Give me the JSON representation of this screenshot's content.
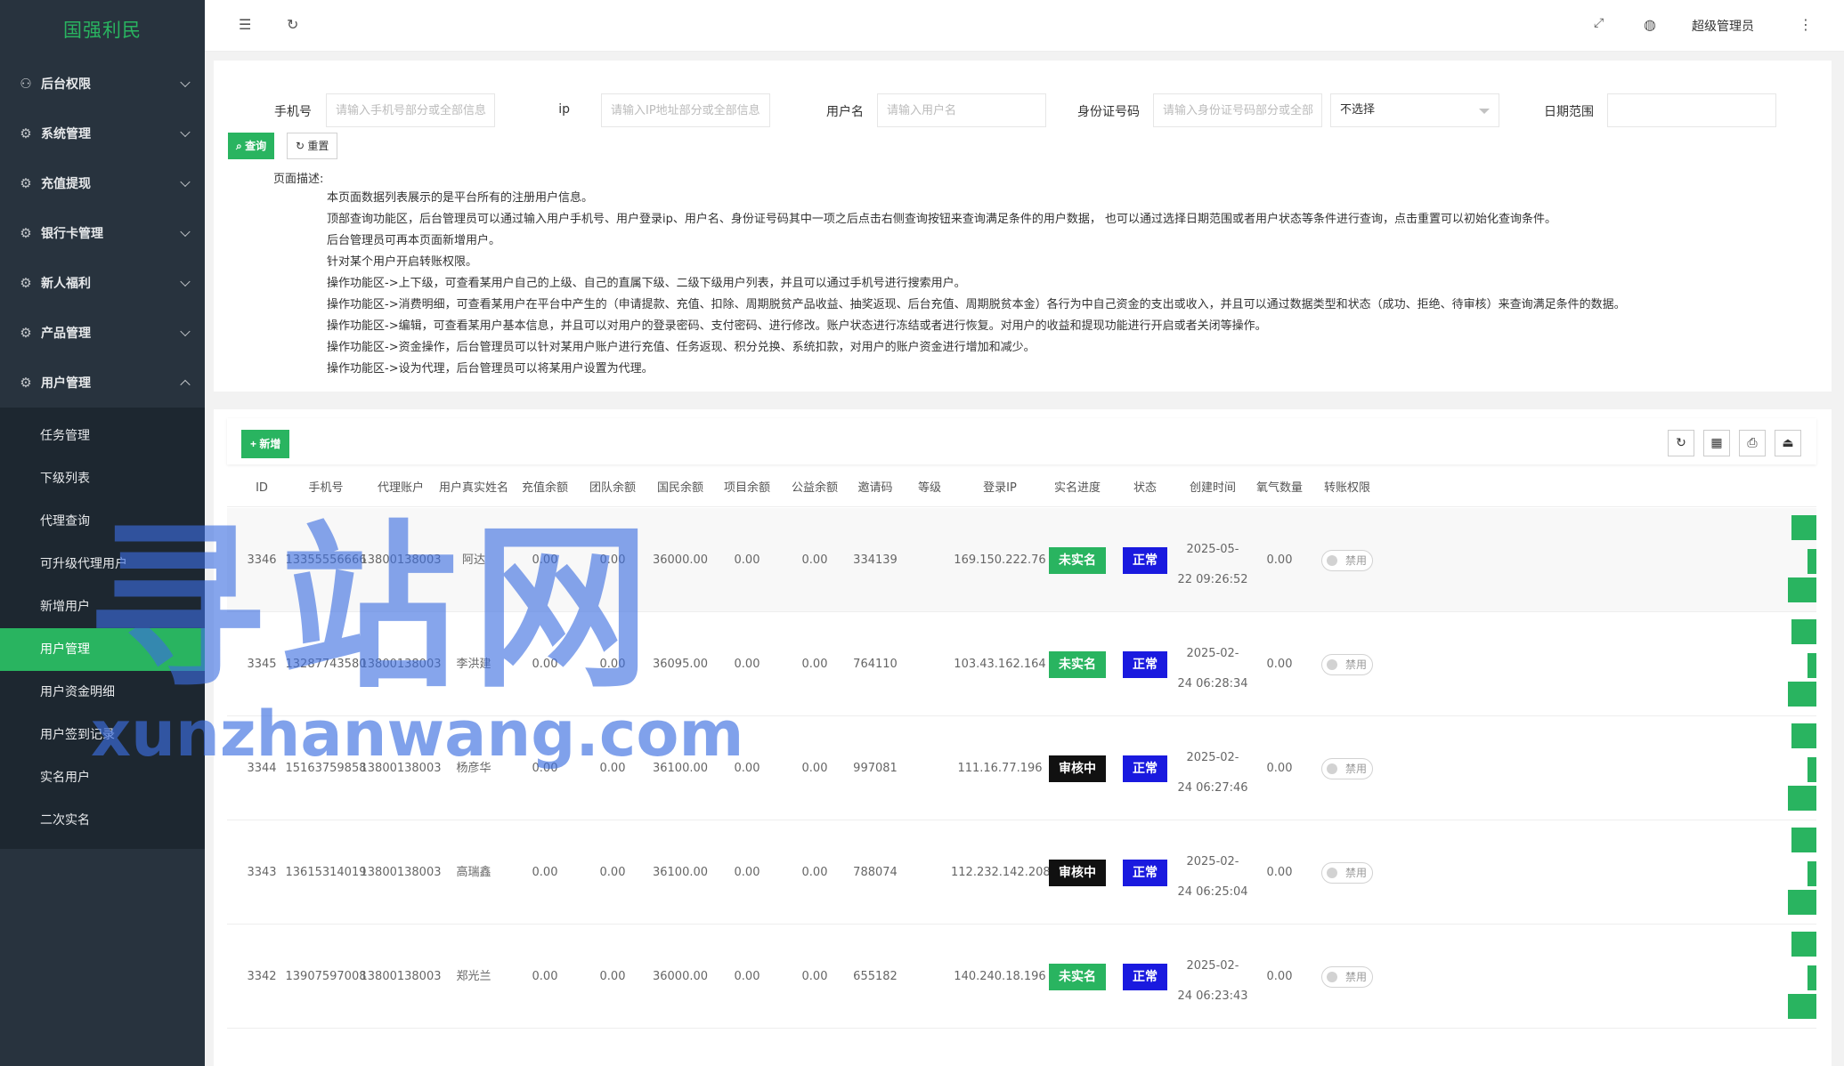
{
  "sidebar": {
    "logo": "国强利民",
    "menus": [
      {
        "label": "后台权限",
        "icon": "user-icon"
      },
      {
        "label": "系统管理",
        "icon": "gear-icon"
      },
      {
        "label": "充值提现",
        "icon": "gear-icon"
      },
      {
        "label": "银行卡管理",
        "icon": "gear-icon"
      },
      {
        "label": "新人福利",
        "icon": "gear-icon"
      },
      {
        "label": "产品管理",
        "icon": "gear-icon"
      },
      {
        "label": "用户管理",
        "icon": "gear-icon"
      }
    ],
    "submenu": [
      "任务管理",
      "下级列表",
      "代理查询",
      "可升级代理用户",
      "新增用户",
      "用户管理",
      "用户资金明细",
      "用户签到记录",
      "实名用户",
      "二次实名"
    ],
    "active_submenu": "用户管理"
  },
  "header": {
    "user": "超级管理员"
  },
  "search": {
    "phone_label": "手机号",
    "phone_placeholder": "请输入手机号部分或全部信息",
    "ip_label": "ip",
    "ip_placeholder": "请输入IP地址部分或全部信息",
    "username_label": "用户名",
    "username_placeholder": "请输入用户名",
    "idcard_label": "身份证号码",
    "idcard_placeholder": "请输入身份证号码部分或全部信息",
    "status_select": "不选择",
    "date_label": "日期范围",
    "query_btn": "查询",
    "reset_btn": "重置"
  },
  "description": {
    "title": "页面描述:",
    "lines": [
      "本页面数据列表展示的是平台所有的注册用户信息。",
      "顶部查询功能区，后台管理员可以通过输入用户手机号、用户登录ip、用户名、身份证号码其中一项之后点击右侧查询按钮来查询满足条件的用户数据， 也可以通过选择日期范围或者用户状态等条件进行查询，点击重置可以初始化查询条件。",
      "后台管理员可再本页面新增用户。",
      "针对某个用户开启转账权限。",
      "操作功能区->上下级，可查看某用户自己的上级、自己的直属下级、二级下级用户列表，并且可以通过手机号进行搜索用户。",
      "操作功能区->消费明细，可查看某用户在平台中产生的（申请提款、充值、扣除、周期脱贫产品收益、抽奖返现、后台充值、周期脱贫本金）各行为中自己资金的支出或收入，并且可以通过数据类型和状态（成功、拒绝、待审核）来查询满足条件的数据。",
      "操作功能区->编辑，可查看某用户基本信息，并且可以对用户的登录密码、支付密码、进行修改。账户状态进行冻结或者进行恢复。对用户的收益和提现功能进行开启或者关闭等操作。",
      "操作功能区->资金操作，后台管理员可以针对某用户账户进行充值、任务返现、积分兑换、系统扣款，对用户的账户资金进行增加和减少。",
      "操作功能区->设为代理，后台管理员可以将某用户设置为代理。"
    ]
  },
  "table": {
    "add_btn": "新增",
    "columns": [
      "ID",
      "手机号",
      "代理账户",
      "用户真实姓名",
      "充值余额",
      "团队余额",
      "国民余额",
      "项目余额",
      "公益余额",
      "邀请码",
      "等级",
      "登录IP",
      "实名进度",
      "状态",
      "创建时间",
      "氧气数量",
      "转账权限"
    ],
    "rows": [
      {
        "id": "3346",
        "phone": "13355556666",
        "agent": "13800138003",
        "name": "阿达",
        "recharge": "0.00",
        "team": "0.00",
        "national": "36000.00",
        "project": "0.00",
        "charity": "0.00",
        "invite": "334139",
        "level": "",
        "ip": "169.150.222.76",
        "realname": "未实名",
        "status": "正常",
        "date1": "2025-05-",
        "date2": "22 09:26:52",
        "oxygen": "0.00",
        "transfer": "禁用"
      },
      {
        "id": "3345",
        "phone": "13287743580",
        "agent": "13800138003",
        "name": "李洪建",
        "recharge": "0.00",
        "team": "0.00",
        "national": "36095.00",
        "project": "0.00",
        "charity": "0.00",
        "invite": "764110",
        "level": "",
        "ip": "103.43.162.164",
        "realname": "未实名",
        "status": "正常",
        "date1": "2025-02-",
        "date2": "24 06:28:34",
        "oxygen": "0.00",
        "transfer": "禁用"
      },
      {
        "id": "3344",
        "phone": "15163759858",
        "agent": "13800138003",
        "name": "杨彦华",
        "recharge": "0.00",
        "team": "0.00",
        "national": "36100.00",
        "project": "0.00",
        "charity": "0.00",
        "invite": "997081",
        "level": "",
        "ip": "111.16.77.196",
        "realname": "审核中",
        "status": "正常",
        "date1": "2025-02-",
        "date2": "24 06:27:46",
        "oxygen": "0.00",
        "transfer": "禁用"
      },
      {
        "id": "3343",
        "phone": "13615314019",
        "agent": "13800138003",
        "name": "高瑞鑫",
        "recharge": "0.00",
        "team": "0.00",
        "national": "36100.00",
        "project": "0.00",
        "charity": "0.00",
        "invite": "788074",
        "level": "",
        "ip": "112.232.142.208",
        "realname": "审核中",
        "status": "正常",
        "date1": "2025-02-",
        "date2": "24 06:25:04",
        "oxygen": "0.00",
        "transfer": "禁用"
      },
      {
        "id": "3342",
        "phone": "13907597008",
        "agent": "13800138003",
        "name": "郑光兰",
        "recharge": "0.00",
        "team": "0.00",
        "national": "36000.00",
        "project": "0.00",
        "charity": "0.00",
        "invite": "655182",
        "level": "",
        "ip": "140.240.18.196",
        "realname": "未实名",
        "status": "正常",
        "date1": "2025-02-",
        "date2": "24 06:23:43",
        "oxygen": "0.00",
        "transfer": "禁用"
      }
    ]
  },
  "watermark": {
    "big": "寻站网",
    "small": "xunzhanwang.com"
  },
  "colors": {
    "accent": "#29b460",
    "sidebar": "#28333e",
    "status_blue": "#1a1adf",
    "pending_black": "#111111"
  }
}
